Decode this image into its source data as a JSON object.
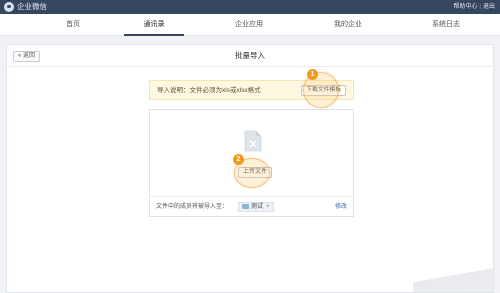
{
  "app": {
    "brand": "企业微信",
    "help_label": "帮助中心",
    "logout_label": "退出",
    "separator": "|"
  },
  "nav": {
    "tabs": [
      {
        "label": "首页"
      },
      {
        "label": "通讯录"
      },
      {
        "label": "企业应用"
      },
      {
        "label": "我的企业"
      },
      {
        "label": "系统日志"
      }
    ],
    "active_tab": "通讯录"
  },
  "panel": {
    "back_label": "« 返回",
    "title": "批量导入"
  },
  "notice": {
    "text": "导入说明：文件必须为xls或xlsx格式",
    "download_label": "下载文件模板"
  },
  "upload": {
    "button_label": "上传文件",
    "target_label": "文件中的成员将被导入至：",
    "department": "测试",
    "remove_symbol": "×",
    "edit_label": "修改"
  },
  "steps": {
    "one": "1",
    "two": "2"
  },
  "colors": {
    "topbar": "#35465f",
    "notice_bg": "#fff8e1",
    "badge": "#f39a1c",
    "link": "#3a6ea8"
  },
  "icons": {
    "logo": "wework-logo-icon",
    "file": "excel-file-icon",
    "folder": "folder-icon"
  }
}
